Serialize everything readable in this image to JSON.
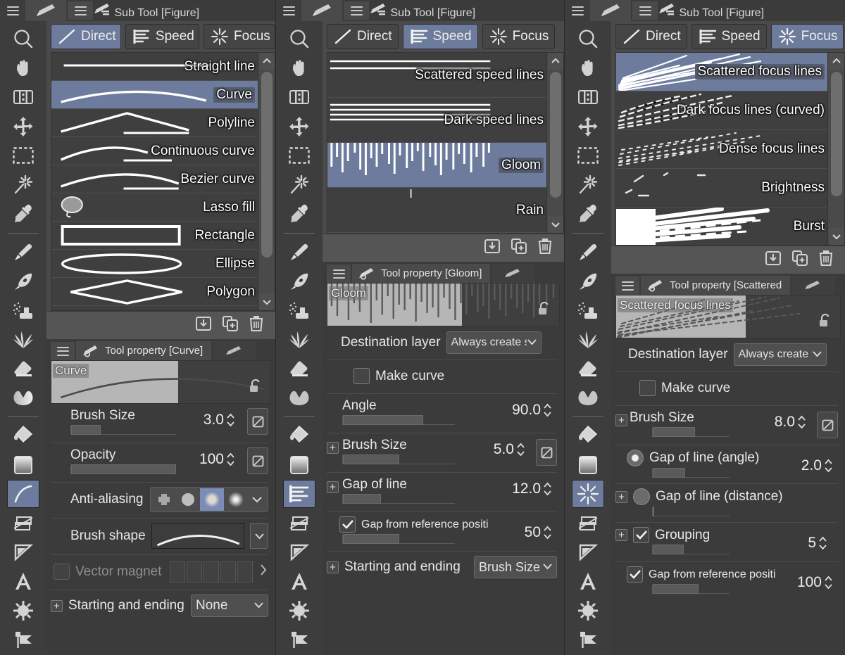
{
  "app": {
    "window_title": "Sub Tool [Figure]",
    "accent_selection": "#6d7b9c",
    "panel_bg": "#3b3b3b",
    "list_bg": "#3f3f3f"
  },
  "panels": [
    {
      "id": "direct-draw",
      "subtool_title": "Sub Tool [Figure]",
      "tool_property_title": "Tool property [Curve]",
      "segments": [
        {
          "label": "Direct",
          "icon": "direct-draw-icon",
          "selected": true
        },
        {
          "label": "Speed",
          "icon": "speed-lines-icon",
          "selected": false
        },
        {
          "label": "Focus",
          "icon": "focus-lines-icon",
          "selected": false
        }
      ],
      "subtools": [
        {
          "label": "Straight line",
          "icon": "straight-line-icon",
          "selected": false
        },
        {
          "label": "Curve",
          "icon": "curve-icon",
          "selected": true
        },
        {
          "label": "Polyline",
          "icon": "polyline-icon",
          "selected": false
        },
        {
          "label": "Continuous curve",
          "icon": "continuous-curve-icon",
          "selected": false
        },
        {
          "label": "Bezier curve",
          "icon": "bezier-curve-icon",
          "selected": false
        },
        {
          "label": "Lasso fill",
          "icon": "lasso-fill-icon",
          "selected": false
        },
        {
          "label": "Rectangle",
          "icon": "rectangle-icon",
          "selected": false
        },
        {
          "label": "Ellipse",
          "icon": "ellipse-icon",
          "selected": false
        },
        {
          "label": "Polygon",
          "icon": "polygon-icon",
          "selected": false
        }
      ],
      "footer_icons": [
        "import-subtool-icon",
        "duplicate-subtool-icon",
        "delete-subtool-icon"
      ],
      "preview_name": "Curve",
      "properties": [
        {
          "type": "slider",
          "label": "Brush Size",
          "value": "3.0",
          "fill": 28,
          "has_plus": false,
          "has_sqbtn": true
        },
        {
          "type": "slider",
          "label": "Opacity",
          "value": "100",
          "fill": 100,
          "has_plus": false,
          "has_sqbtn": true
        },
        {
          "type": "antialias",
          "label": "Anti-aliasing",
          "options": [
            "none",
            "weak",
            "medium",
            "strong"
          ],
          "selected_index": 2
        },
        {
          "type": "brushshape",
          "label": "Brush shape"
        },
        {
          "type": "vectormagnet",
          "label": "Vector magnet",
          "enabled": false,
          "cells": 5
        },
        {
          "type": "combo",
          "label": "Starting and ending",
          "value": "None",
          "has_plus": true
        }
      ]
    },
    {
      "id": "speed-lines",
      "subtool_title": "Sub Tool [Figure]",
      "tool_property_title": "Tool property [Gloom]",
      "segments": [
        {
          "label": "Direct",
          "icon": "direct-draw-icon",
          "selected": false
        },
        {
          "label": "Speed",
          "icon": "speed-lines-icon",
          "selected": true
        },
        {
          "label": "Focus",
          "icon": "focus-lines-icon",
          "selected": false
        }
      ],
      "subtools": [
        {
          "label": "Scattered speed lines",
          "icon": "scattered-speed-lines-icon",
          "selected": false
        },
        {
          "label": "Dark speed lines",
          "icon": "dark-speed-lines-icon",
          "selected": false
        },
        {
          "label": "Gloom",
          "icon": "gloom-icon",
          "selected": true
        },
        {
          "label": "Rain",
          "icon": "rain-icon",
          "selected": false
        }
      ],
      "footer_icons": [
        "import-subtool-icon",
        "duplicate-subtool-icon",
        "delete-subtool-icon"
      ],
      "preview_name": "Gloom",
      "properties": [
        {
          "type": "combo",
          "label": "Destination layer",
          "value": "Always create sp",
          "has_plus": false
        },
        {
          "type": "checkbox",
          "label": "Make curve",
          "checked": false
        },
        {
          "type": "slider",
          "label": "Angle",
          "value": "90.0",
          "fill": 72,
          "has_plus": false,
          "has_sqbtn": false
        },
        {
          "type": "slider",
          "label": "Brush Size",
          "value": "5.0",
          "fill": 50,
          "has_plus": true,
          "has_sqbtn": true
        },
        {
          "type": "slider",
          "label": "Gap of line",
          "value": "12.0",
          "fill": 34,
          "has_plus": true,
          "has_sqbtn": false
        },
        {
          "type": "checkslider",
          "label": "Gap from reference positi",
          "value": "50",
          "fill": 50,
          "checked": true
        },
        {
          "type": "combo",
          "label": "Starting and ending",
          "value": "Brush Size",
          "has_plus": true
        }
      ]
    },
    {
      "id": "focus-lines",
      "subtool_title": "Sub Tool [Figure]",
      "tool_property_title": "Tool property [Scattered",
      "segments": [
        {
          "label": "Direct",
          "icon": "direct-draw-icon",
          "selected": false
        },
        {
          "label": "Speed",
          "icon": "speed-lines-icon",
          "selected": false
        },
        {
          "label": "Focus",
          "icon": "focus-lines-icon",
          "selected": true
        }
      ],
      "subtools": [
        {
          "label": "Scattered focus lines",
          "icon": "scattered-focus-lines-icon",
          "selected": true
        },
        {
          "label": "Dark focus lines (curved)",
          "icon": "dark-focus-lines-curved-icon",
          "selected": false
        },
        {
          "label": "Dense focus lines",
          "icon": "dense-focus-lines-icon",
          "selected": false
        },
        {
          "label": "Brightness",
          "icon": "brightness-icon",
          "selected": false
        },
        {
          "label": "Burst",
          "icon": "burst-icon",
          "selected": false
        }
      ],
      "footer_icons": [
        "import-subtool-icon",
        "duplicate-subtool-icon",
        "delete-subtool-icon"
      ],
      "preview_name": "Scattered focus lines",
      "properties": [
        {
          "type": "combo",
          "label": "Destination layer",
          "value": "Always create fo",
          "has_plus": false
        },
        {
          "type": "checkbox",
          "label": "Make curve",
          "checked": false
        },
        {
          "type": "slider",
          "label": "Brush Size",
          "value": "8.0",
          "fill": 55,
          "has_plus": true,
          "has_sqbtn": true
        },
        {
          "type": "radioslider",
          "label": "Gap of line (angle)",
          "value": "2.0",
          "fill": 42,
          "selected": true,
          "has_plus": false
        },
        {
          "type": "radioslider",
          "label": "Gap of line (distance)",
          "value": "",
          "fill": 0,
          "selected": false,
          "has_plus": true
        },
        {
          "type": "checkslider",
          "label": "Grouping",
          "value": "5",
          "fill": 40,
          "checked": true,
          "has_plus": true
        },
        {
          "type": "checkslider",
          "label": "Gap from reference positi",
          "value": "100",
          "fill": 60,
          "checked": true
        }
      ]
    }
  ],
  "toolbar": {
    "items": [
      {
        "name": "zoom-tool",
        "icon": "magnifier-icon"
      },
      {
        "name": "hand-tool",
        "icon": "hand-icon"
      },
      {
        "name": "rotate-tool",
        "icon": "rotate-canvas-icon"
      },
      {
        "name": "move-tool",
        "icon": "move-arrows-icon"
      },
      {
        "name": "select-tool",
        "icon": "marquee-select-icon"
      },
      {
        "name": "auto-select-tool",
        "icon": "magic-wand-icon"
      },
      {
        "name": "eyedropper-tool",
        "icon": "eyedropper-icon"
      },
      {
        "name": "pen-tool",
        "icon": "pen-icon",
        "divider_before": true
      },
      {
        "name": "brush-tool",
        "icon": "brush-icon"
      },
      {
        "name": "airbrush-tool",
        "icon": "airbrush-icon"
      },
      {
        "name": "decoration-tool",
        "icon": "decoration-grass-icon"
      },
      {
        "name": "eraser-tool",
        "icon": "eraser-icon"
      },
      {
        "name": "blend-tool",
        "icon": "blend-icon"
      },
      {
        "name": "fill-tool",
        "icon": "fill-bucket-icon",
        "divider_before": true
      },
      {
        "name": "gradient-tool",
        "icon": "gradient-icon"
      },
      {
        "name": "figure-tool",
        "icon": "figure-curve-icon"
      },
      {
        "name": "frame-border-tool",
        "icon": "frame-border-icon"
      },
      {
        "name": "ruler-tool",
        "icon": "ruler-icon"
      },
      {
        "name": "text-tool",
        "icon": "text-a-icon"
      },
      {
        "name": "balloon-tool",
        "icon": "balloon-burst-icon"
      },
      {
        "name": "correct-line-tool",
        "icon": "correct-line-icon"
      }
    ],
    "selected_index_per_panel": [
      15,
      15,
      15
    ]
  }
}
